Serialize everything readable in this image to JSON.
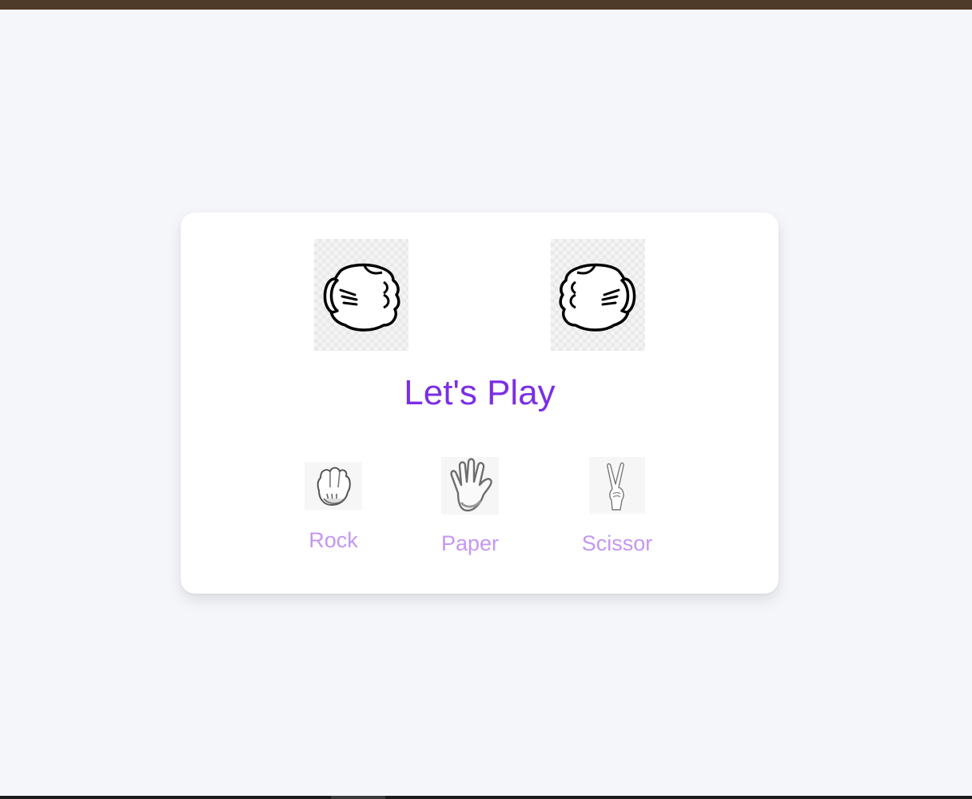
{
  "game": {
    "title": "Let's Play",
    "player_hand": "rock-fist-icon",
    "computer_hand": "rock-fist-icon",
    "choices": [
      {
        "label": "Rock",
        "icon": "rock-glove-icon"
      },
      {
        "label": "Paper",
        "icon": "paper-hand-icon"
      },
      {
        "label": "Scissor",
        "icon": "scissor-hand-icon"
      }
    ]
  },
  "colors": {
    "title": "#7a2ee6",
    "choice_label": "#c497f2",
    "background": "#f5f6fa",
    "top_bar": "#4e3b29"
  }
}
